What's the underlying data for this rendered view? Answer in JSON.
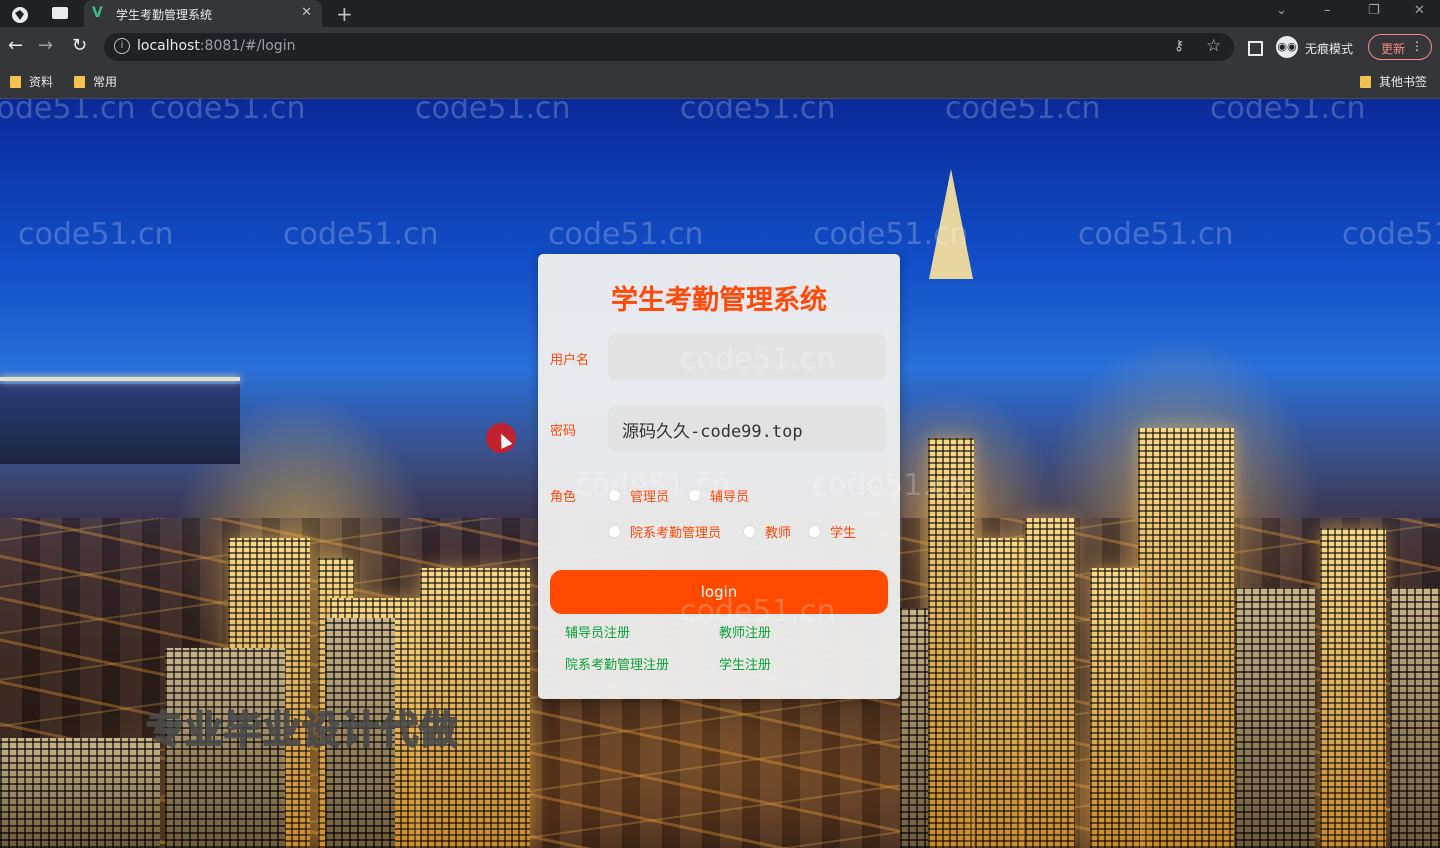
{
  "browser": {
    "tab_title": "学生考勤管理系统",
    "tab_favicon": "V",
    "url_host": "localhost",
    "url_path": ":8081/#/login",
    "incognito_label": "无痕模式",
    "update_label": "更新",
    "bookmarks": [
      "资料",
      "常用"
    ],
    "other_bookmarks": "其他书签"
  },
  "page": {
    "watermark": "code51.cn",
    "slogan": "专业毕业设计代做"
  },
  "login": {
    "title": "学生考勤管理系统",
    "username_label": "用户名",
    "username_value": "",
    "password_label": "密码",
    "password_value": "源码久久-code99.top",
    "role_label": "角色",
    "roles": [
      "管理员",
      "辅导员",
      "院系考勤管理员",
      "教师",
      "学生"
    ],
    "login_button": "login",
    "register_links": [
      "辅导员注册",
      "教师注册",
      "院系考勤管理注册",
      "学生注册"
    ]
  },
  "colors": {
    "accent": "#ff4a00",
    "register_link": "#0fa23b",
    "card_bg": "#eeeeee"
  }
}
